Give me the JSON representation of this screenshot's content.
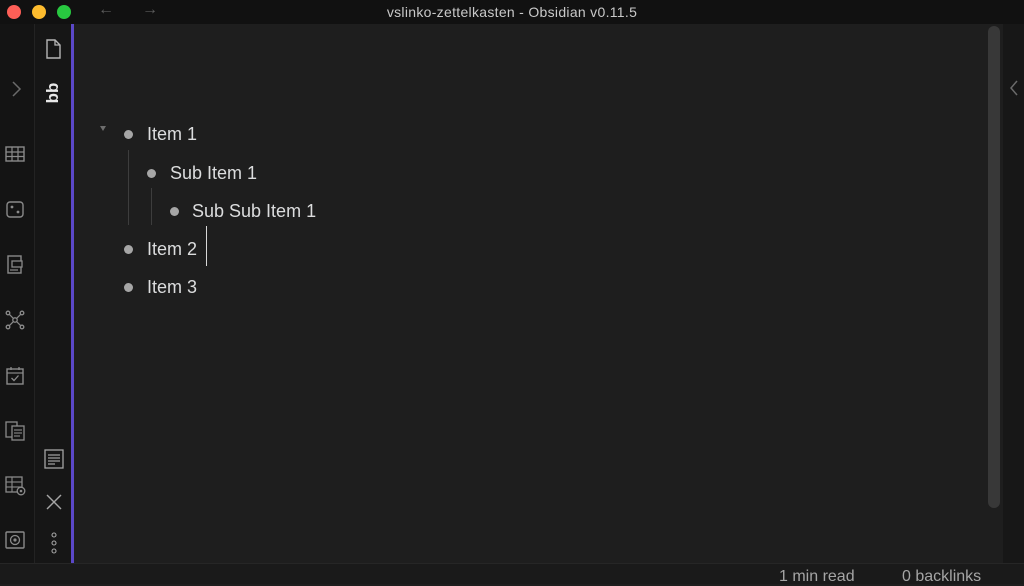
{
  "window": {
    "title": "vslinko-zettelkasten - Obsidian v0.11.5",
    "back_arrow": "←",
    "forward_arrow": "→"
  },
  "ribbon": {
    "icons": [
      "chevron-right-icon",
      "table-icon",
      "dice-icon",
      "template-icon",
      "graph-icon",
      "calendar-icon",
      "files-copy-icon",
      "table-settings-icon",
      "vault-icon"
    ]
  },
  "tab_strip": {
    "tab_label": "bb",
    "icons": [
      "file-icon",
      "outline-icon",
      "close-icon",
      "more-options-icon"
    ]
  },
  "editor": {
    "items": [
      {
        "text": "Item 1",
        "level": 0
      },
      {
        "text": "Sub Item 1",
        "level": 1
      },
      {
        "text": "Sub Sub Item 1",
        "level": 2
      },
      {
        "text": "Item 2",
        "level": 0
      },
      {
        "text": "Item 3",
        "level": 0
      }
    ]
  },
  "status_bar": {
    "reading_time": "1 min read",
    "backlinks": "0 backlinks"
  },
  "colors": {
    "accent": "#5b48c8",
    "close": "#fe5f57",
    "minimize": "#febc2e",
    "maximize": "#28c840"
  }
}
